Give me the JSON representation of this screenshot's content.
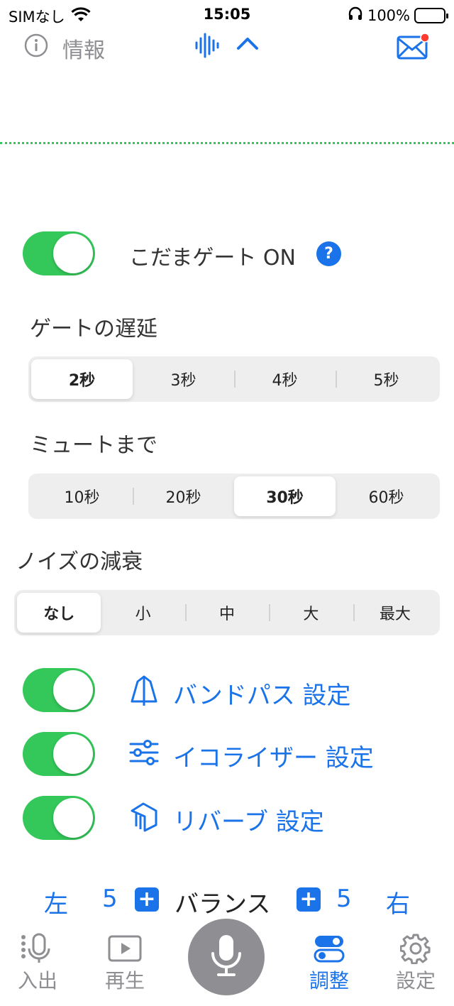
{
  "status_bar": {
    "carrier": "SIMなし",
    "time": "15:05",
    "battery": "100%"
  },
  "toolbar": {
    "info_label": "情報"
  },
  "gate": {
    "label": "こだまゲート ON",
    "help": "?",
    "on": true
  },
  "delay": {
    "title": "ゲートの遅延",
    "options": [
      "2秒",
      "3秒",
      "4秒",
      "5秒"
    ],
    "selected": "2秒"
  },
  "mute": {
    "title": "ミュートまで",
    "options": [
      "10秒",
      "20秒",
      "30秒",
      "60秒"
    ],
    "selected": "30秒"
  },
  "noise": {
    "title": "ノイズの減衰",
    "options": [
      "なし",
      "小",
      "中",
      "大",
      "最大"
    ],
    "selected": "なし"
  },
  "features": [
    {
      "label": "バンドパス 設定",
      "icon": "bandpass-icon",
      "on": true
    },
    {
      "label": "イコライザー 設定",
      "icon": "equalizer-icon",
      "on": true
    },
    {
      "label": "リバーブ 設定",
      "icon": "reverb-icon",
      "on": true
    }
  ],
  "balance": {
    "left_label": "左",
    "left_value": "5",
    "title": "バランス",
    "right_value": "5",
    "right_label": "右",
    "plus": "+"
  },
  "tabs": {
    "io": "入出",
    "playback": "再生",
    "adjust": "調整",
    "settings": "設定"
  },
  "colors": {
    "accent": "#1a73e8",
    "toggle_on": "#34c759",
    "inactive": "#8e8e93",
    "badge": "#ff3b30"
  }
}
